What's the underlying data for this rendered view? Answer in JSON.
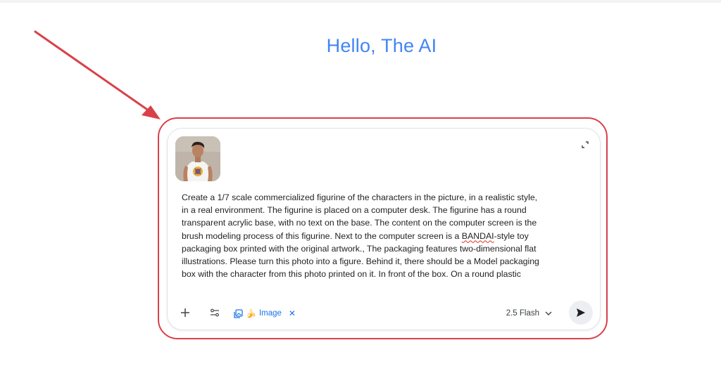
{
  "greeting": "Hello, The AI",
  "composer": {
    "attachment_alt": "Attached photo of a man in a white t-shirt",
    "prompt_lines": [
      "Create a 1/7 scale commercialized figurine of the characters in the picture, in a realistic style,",
      "in a real environment. The figurine is placed on a computer desk. The figurine has a round",
      "transparent acrylic base, with no text on the base. The content on the computer screen is the",
      "brush modeling process of this figurine. Next to the computer screen is a ",
      "BANDAI",
      "-style toy",
      "packaging box printed with the original artwork., The packaging features two-dimensional flat",
      "illustrations. Please turn this photo into a figure. Behind it, there should be a Model packaging",
      "box with the character from this photo printed on it. In front of the box. On a round plastic"
    ],
    "toolbar": {
      "chip_label": "Image",
      "chip_emoji": "🍌",
      "chip_close": "✕",
      "model_label": "2.5 Flash"
    }
  },
  "colors": {
    "accent_blue": "#1a73e8",
    "greeting_blue": "#4285f4",
    "highlight_red": "#d9414a"
  }
}
